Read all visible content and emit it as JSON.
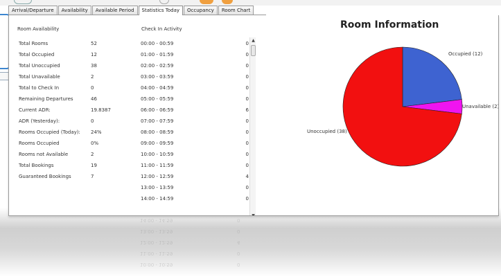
{
  "tabs": [
    {
      "label": "Arrival/Departure",
      "active": false
    },
    {
      "label": "Availability",
      "active": false
    },
    {
      "label": "Available Period",
      "active": false
    },
    {
      "label": "Statistics Today",
      "active": true
    },
    {
      "label": "Occupancy",
      "active": false
    },
    {
      "label": "Room Chart",
      "active": false
    }
  ],
  "room_availability": {
    "title": "Room Availability",
    "rows": [
      {
        "label": "Total Rooms",
        "value": "52"
      },
      {
        "label": "Total Occupied",
        "value": "12"
      },
      {
        "label": "Total Unoccupied",
        "value": "38"
      },
      {
        "label": "Total Unavailable",
        "value": "2"
      },
      {
        "label": "Total to Check In",
        "value": "0"
      },
      {
        "label": "Remaining Departures",
        "value": "46"
      },
      {
        "label": "Current ADR:",
        "value": "19.8387"
      },
      {
        "label": "ADR (Yesterday):",
        "value": "0"
      },
      {
        "label": "Rooms Occupied (Today):",
        "value": "24%"
      },
      {
        "label": "Rooms Occupied",
        "value": "0%"
      },
      {
        "label": "Rooms not Available",
        "value": "2"
      },
      {
        "label": "Total Bookings",
        "value": "19"
      },
      {
        "label": "Guaranteed Bookings",
        "value": "7"
      }
    ]
  },
  "check_in_activity": {
    "title": "Check In Activity",
    "rows": [
      {
        "time": "00:00 - 00:59",
        "count": "0"
      },
      {
        "time": "01:00 - 01:59",
        "count": "0"
      },
      {
        "time": "02:00 - 02:59",
        "count": "0"
      },
      {
        "time": "03:00 - 03:59",
        "count": "0"
      },
      {
        "time": "04:00 - 04:59",
        "count": "0"
      },
      {
        "time": "05:00 - 05:59",
        "count": "0"
      },
      {
        "time": "06:00 - 06:59",
        "count": "6"
      },
      {
        "time": "07:00 - 07:59",
        "count": "0"
      },
      {
        "time": "08:00 - 08:59",
        "count": "0"
      },
      {
        "time": "09:00 - 09:59",
        "count": "0"
      },
      {
        "time": "10:00 - 10:59",
        "count": "0"
      },
      {
        "time": "11:00 - 11:59",
        "count": "0"
      },
      {
        "time": "12:00 - 12:59",
        "count": "4"
      },
      {
        "time": "13:00 - 13:59",
        "count": "0"
      },
      {
        "time": "14:00 - 14:59",
        "count": "0"
      }
    ]
  },
  "scrollbar": {
    "up_glyph": "▲",
    "down_glyph": "▼"
  },
  "chart_data": {
    "type": "pie",
    "title": "Room Information",
    "slices": [
      {
        "label": "Occupied (12)",
        "value": 12,
        "color": "#3e63d1"
      },
      {
        "label": "Unavailable (2)",
        "value": 2,
        "color": "#f014f0"
      },
      {
        "label": "Unoccupied (38)",
        "value": 38,
        "color": "#f21010"
      }
    ]
  }
}
